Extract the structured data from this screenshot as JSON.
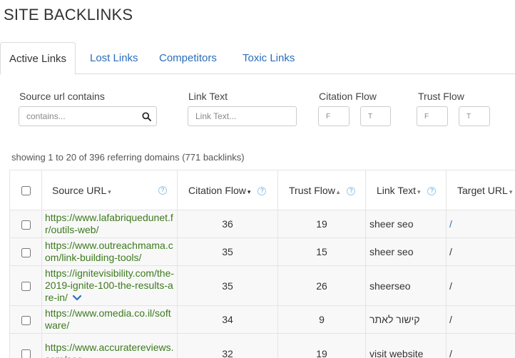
{
  "page": {
    "title": "SITE BACKLINKS"
  },
  "tabs": [
    {
      "label": "Active Links",
      "active": true
    },
    {
      "label": "Lost Links"
    },
    {
      "label": "Competitors"
    },
    {
      "label": "Toxic Links"
    }
  ],
  "filters": {
    "source_url": {
      "label": "Source url contains",
      "placeholder": "contains..."
    },
    "link_text": {
      "label": "Link Text",
      "placeholder": "Link Text..."
    },
    "citation_flow": {
      "label": "Citation Flow",
      "from_placeholder": "F",
      "to_placeholder": "T"
    },
    "trust_flow": {
      "label": "Trust Flow",
      "from_placeholder": "F",
      "to_placeholder": "T"
    }
  },
  "summary": "showing 1 to 20 of 396 referring domains (771 backlinks)",
  "table": {
    "headers": {
      "source_url": "Source URL",
      "citation_flow": "Citation Flow",
      "trust_flow": "Trust Flow",
      "link_text": "Link Text",
      "target_url": "Target URL",
      "help": "?",
      "sort_desc": "▾",
      "sort_asc": "▴"
    },
    "rows": [
      {
        "source": "https://www.lafabriquedunet.fr/outils-web/",
        "cf": "36",
        "tf": "19",
        "text": "sheer seo",
        "target": "/"
      },
      {
        "source": "https://www.outreachmama.com/link-building-tools/",
        "cf": "35",
        "tf": "15",
        "text": "sheer seo",
        "target": "/"
      },
      {
        "source": "https://ignitevisibility.com/the-2019-ignite-100-the-results-are-in/",
        "cf": "35",
        "tf": "26",
        "text": "sheerseo",
        "target": "/"
      },
      {
        "source": "https://www.omedia.co.il/software/",
        "cf": "34",
        "tf": "9",
        "text": "קישור לאתר",
        "target": "/"
      },
      {
        "source": "https://www.accuratereviews.com/seo-",
        "cf": "32",
        "tf": "19",
        "text": "visit website",
        "target": "/"
      }
    ]
  },
  "colors": {
    "link": "#2a6ebb",
    "source_link": "#3d7a1e",
    "row_bg": "#f8f8f8"
  },
  "icons": {
    "search": "search-icon",
    "expand": "chevron-down-icon",
    "help": "help-icon"
  }
}
